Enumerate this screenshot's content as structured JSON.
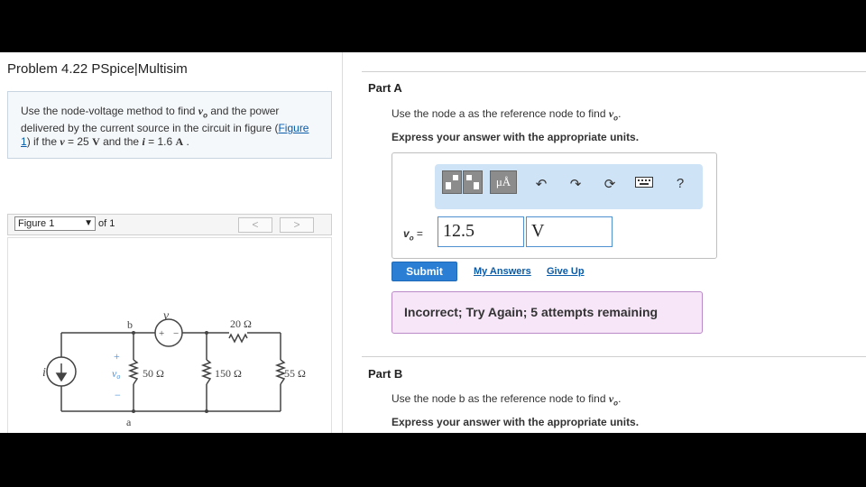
{
  "problem": {
    "title": "Problem 4.22 PSpice|Multisim",
    "text_pre": "Use the node-voltage method to find ",
    "vo_sym": "v",
    "vo_sub": "o",
    "text_mid1": " and the power delivered by the current source in the circuit in figure (",
    "figure_link": "Figure 1",
    "text_mid2": ") if the ",
    "v_sym": "v",
    "v_val": " = 25 ",
    "v_unit": "V",
    "text_mid3": " and the ",
    "i_sym": "i",
    "i_val": " = 1.6 ",
    "i_unit": "A",
    "text_end": " ."
  },
  "figure_nav": {
    "select_value": "Figure 1",
    "of_label": "of 1",
    "prev": "<",
    "next": ">"
  },
  "circuit": {
    "v_label": "v",
    "b_label": "b",
    "a_label": "a",
    "i_label": "i",
    "r20": "20 Ω",
    "r50": "50 Ω",
    "r150": "150 Ω",
    "r55": "55 Ω",
    "vo_label": "v",
    "vo_sub": "o",
    "plus": "+",
    "minus": "−"
  },
  "partA": {
    "title": "Part A",
    "instr_pre": "Use the node a as the reference node to find ",
    "instr_sym": "v",
    "instr_sub": "o",
    "instr_end": ".",
    "units": "Express your answer with the appropriate units.",
    "toolbar": {
      "units_btn": "μÅ",
      "help": "?"
    },
    "var_label": "v",
    "var_sub": "o",
    "eq": " =",
    "value": "12.5",
    "unit": "V",
    "submit": "Submit",
    "my_answers": "My Answers",
    "give_up": "Give Up",
    "feedback": "Incorrect; Try Again; 5 attempts remaining"
  },
  "partB": {
    "title": "Part B",
    "instr_pre": "Use the node b as the reference node to find ",
    "instr_sym": "v",
    "instr_sub": "o",
    "instr_end": ".",
    "units": "Express your answer with the appropriate units."
  }
}
